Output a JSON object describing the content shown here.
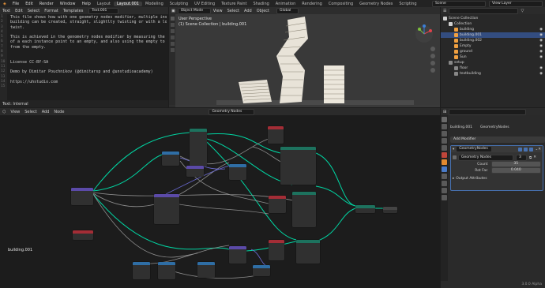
{
  "menubar": {
    "items": [
      "File",
      "Edit",
      "Render",
      "Window",
      "Help"
    ],
    "workspaces": [
      "Layout",
      "Layout.001",
      "Modeling",
      "Sculpting",
      "UV Editing",
      "Texture Paint",
      "Shading",
      "Animation",
      "Rendering",
      "Compositing",
      "Geometry Nodes",
      "Scripting"
    ],
    "active_workspace": "Layout.001",
    "scene_label": "Scene",
    "view_layer_label": "View Layer"
  },
  "text_editor": {
    "header": [
      "Text",
      "Edit",
      "Select",
      "Format",
      "Templates"
    ],
    "text_name": "Text.001",
    "lines": [
      "This file shows how with one geometry nodes modifier, multiple instances of",
      "building can be created, straight, slightlty twisting or with a lot of",
      "twist.",
      "",
      "This is achieved in the genometry nodes modifier by measuring the distance",
      "of a each instance point to an empty, and also using the empty to rotate",
      "from the empty.",
      "",
      "",
      "License CC-BY-SA",
      "",
      "Demo by Dimitar Pouchnikov (@dimitarsp and @unstudioacademy)",
      "",
      "https://uhstudio.com",
      ""
    ],
    "status": "Text: Internal"
  },
  "viewport": {
    "mode": "Object Mode",
    "menus": [
      "View",
      "Select",
      "Add",
      "Object"
    ],
    "orientation": "Global",
    "view_name": "User Perspective",
    "collection_path": "(1) Scene Collection | building.001"
  },
  "outliner": {
    "items": [
      {
        "label": "Scene Collection",
        "depth": 0,
        "icon": "#cfcfcf"
      },
      {
        "label": "Collection",
        "depth": 1,
        "icon": "#cfcfcf"
      },
      {
        "label": "building",
        "depth": 2,
        "icon": "#f0a040"
      },
      {
        "label": "building.001",
        "depth": 2,
        "icon": "#f0a040"
      },
      {
        "label": "building.002",
        "depth": 2,
        "icon": "#f0a040"
      },
      {
        "label": "Empty",
        "depth": 2,
        "icon": "#f0a040"
      },
      {
        "label": "ground",
        "depth": 2,
        "icon": "#f0a040"
      },
      {
        "label": "Sun",
        "depth": 2,
        "icon": "#f0a040"
      },
      {
        "label": "setup",
        "depth": 1,
        "icon": "#888888"
      },
      {
        "label": "floor",
        "depth": 2,
        "icon": "#888888"
      },
      {
        "label": "textbuilding",
        "depth": 2,
        "icon": "#888888"
      }
    ]
  },
  "node_editor": {
    "menus": [
      "View",
      "Select",
      "Add",
      "Node"
    ],
    "tree_name": "Geometry Nodes",
    "object_label": "building.001"
  },
  "properties": {
    "object_name": "building.001",
    "modifier_tab": "GeometryNodes",
    "add_modifier": "Add Modifier",
    "modifier_name": "GeometryNodes",
    "node_group": "Geometry Nodes",
    "node_group_users": "3",
    "fields": [
      {
        "label": "Count",
        "value": "35"
      },
      {
        "label": "Rot Fac",
        "value": "0.040"
      }
    ],
    "output_attributes": "Output Attributes",
    "version": "3.0.0 Alpha"
  },
  "colors": {
    "accent": "#4772b3",
    "geometry_socket": "#00d6a3",
    "header_green": "#1d725e",
    "header_red": "#a32d36",
    "header_blue": "#2f6ea5",
    "header_purple": "#5b4aa8"
  }
}
